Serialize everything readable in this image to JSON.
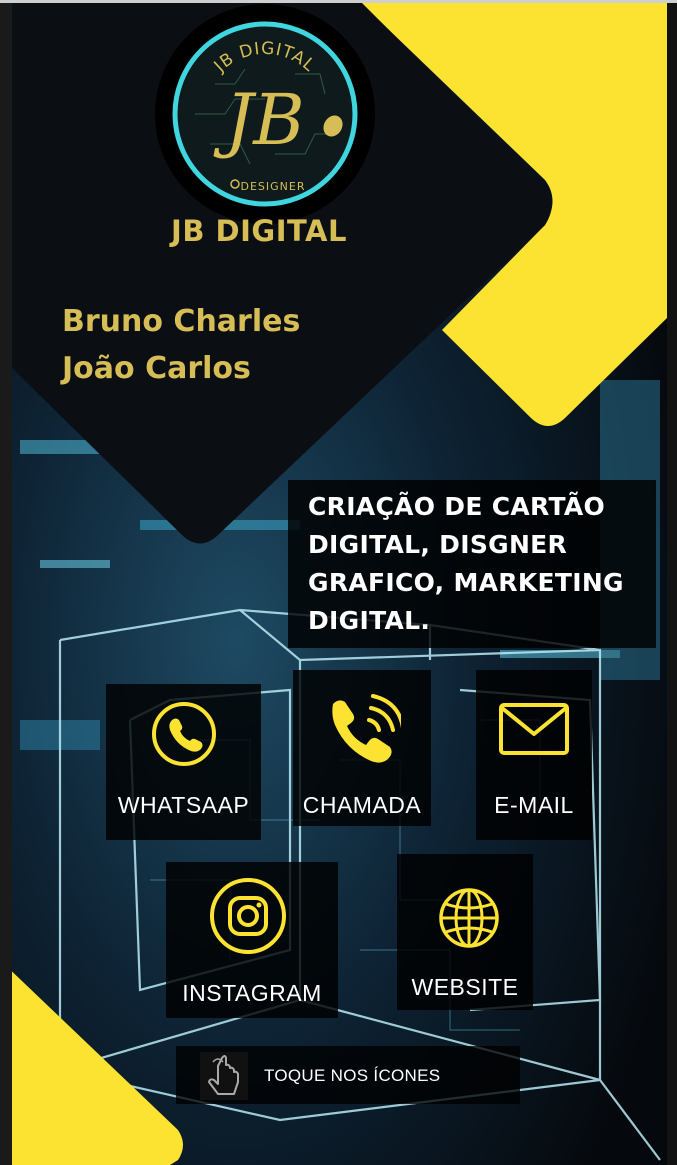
{
  "logo": {
    "ring_text_top": "JB DIGITAL",
    "monogram": "JB",
    "ring_text_bottom": "DESIGNER"
  },
  "brand": "JB DIGITAL",
  "people": [
    "Bruno Charles",
    "João Carlos"
  ],
  "tagline_lines": [
    "CRIAÇÃO DE CARTÃO",
    "DIGITAL, DISGNER",
    "GRAFICO, MARKETING",
    "DIGITAL."
  ],
  "buttons": {
    "whatsapp": {
      "label": "WHATSAAP",
      "icon": "whatsapp-icon"
    },
    "call": {
      "label": "CHAMADA",
      "icon": "phone-icon"
    },
    "email": {
      "label": "E-MAIL",
      "icon": "mail-icon"
    },
    "instagram": {
      "label": "INSTAGRAM",
      "icon": "instagram-icon"
    },
    "website": {
      "label": "WEBSITE",
      "icon": "globe-icon"
    }
  },
  "hint": {
    "label": "TOQUE NOS ÍCONES",
    "icon": "tap-hand-icon"
  },
  "colors": {
    "accent_yellow": "#fce332",
    "gold_text": "#d6bd55",
    "dark": "#0a0e12",
    "neon_cyan": "#3fd6e0"
  }
}
